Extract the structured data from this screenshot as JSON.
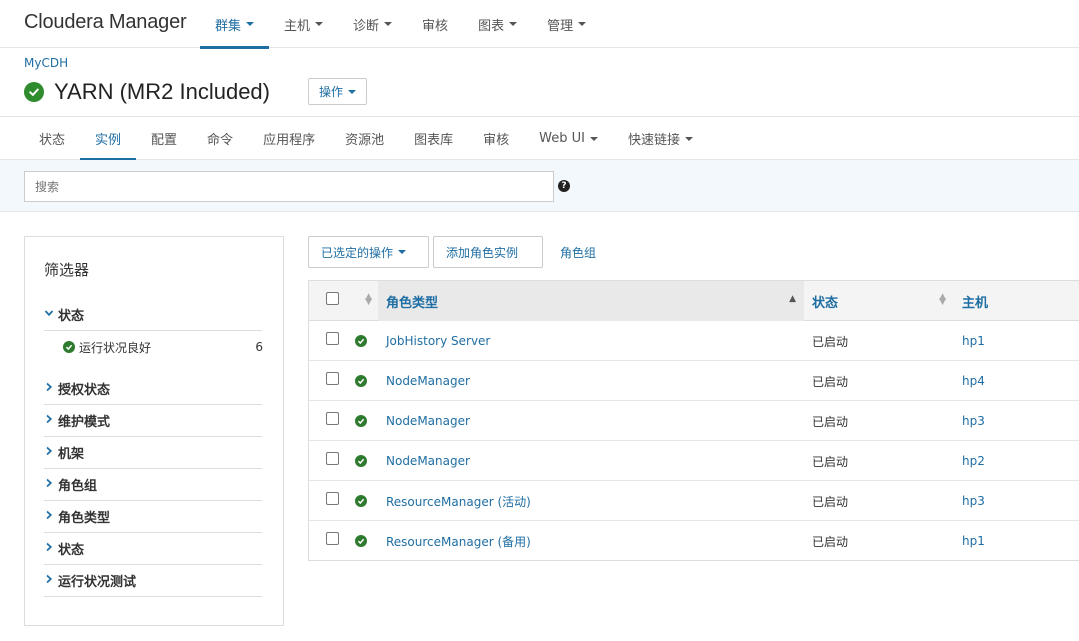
{
  "brand": {
    "part1": "Cloudera",
    "part2": "Manager"
  },
  "topnav": [
    {
      "label": "群集",
      "dropdown": true,
      "active": true
    },
    {
      "label": "主机",
      "dropdown": true,
      "active": false
    },
    {
      "label": "诊断",
      "dropdown": true,
      "active": false
    },
    {
      "label": "审核",
      "dropdown": false,
      "active": false
    },
    {
      "label": "图表",
      "dropdown": true,
      "active": false
    },
    {
      "label": "管理",
      "dropdown": true,
      "active": false
    }
  ],
  "breadcrumb": "MyCDH",
  "page_title": "YARN (MR2 Included)",
  "actions_label": "操作",
  "subtabs": [
    {
      "label": "状态",
      "dropdown": false,
      "active": false
    },
    {
      "label": "实例",
      "dropdown": false,
      "active": true
    },
    {
      "label": "配置",
      "dropdown": false,
      "active": false
    },
    {
      "label": "命令",
      "dropdown": false,
      "active": false
    },
    {
      "label": "应用程序",
      "dropdown": false,
      "active": false
    },
    {
      "label": "资源池",
      "dropdown": false,
      "active": false
    },
    {
      "label": "图表库",
      "dropdown": false,
      "active": false
    },
    {
      "label": "审核",
      "dropdown": false,
      "active": false
    },
    {
      "label": "Web UI",
      "dropdown": true,
      "active": false
    },
    {
      "label": "快速链接",
      "dropdown": true,
      "active": false
    }
  ],
  "search": {
    "placeholder": "搜索",
    "help": "?"
  },
  "filter": {
    "title": "筛选器",
    "expanded_section": "状态",
    "sub_item": {
      "label": "运行状况良好",
      "count": "6"
    },
    "sections": [
      "授权状态",
      "维护模式",
      "机架",
      "角色组",
      "角色类型",
      "状态",
      "运行状况测试"
    ]
  },
  "action_bar": {
    "selected_actions": "已选定的操作",
    "add_role_instances": "添加角色实例",
    "role_groups": "角色组"
  },
  "table": {
    "headers": {
      "role_type": "角色类型",
      "status": "状态",
      "host": "主机"
    },
    "rows": [
      {
        "role": "JobHistory Server",
        "status": "已启动",
        "host": "hp1"
      },
      {
        "role": "NodeManager",
        "status": "已启动",
        "host": "hp4"
      },
      {
        "role": "NodeManager",
        "status": "已启动",
        "host": "hp3"
      },
      {
        "role": "NodeManager",
        "status": "已启动",
        "host": "hp2"
      },
      {
        "role": "ResourceManager (活动)",
        "status": "已启动",
        "host": "hp3"
      },
      {
        "role": "ResourceManager (备用)",
        "status": "已启动",
        "host": "hp1"
      }
    ]
  },
  "colors": {
    "accent": "#1f6ea3",
    "ok": "#2e8b2e"
  }
}
